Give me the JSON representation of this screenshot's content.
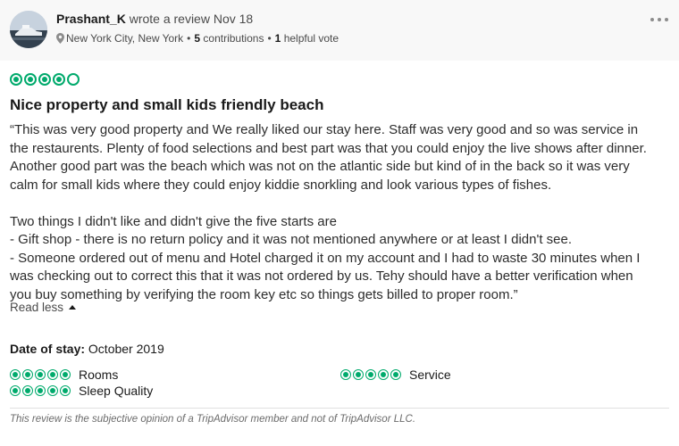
{
  "header": {
    "author_name": "Prashant_K",
    "author_action": "wrote a review Nov 18",
    "location": "New York City, New York",
    "contributions_count": "5",
    "contributions_label": "contributions",
    "helpful_count": "1",
    "helpful_label": "helpful vote",
    "separator": "•"
  },
  "review": {
    "rating": 4,
    "rating_max": 5,
    "title": "Nice property and small kids friendly beach",
    "paragraph1": [
      "“This was very good property and We really liked our stay here. Staff was very good and so was service in",
      "the restaurents. Plenty of food selections and best part was that you could enjoy the live shows after dinner.",
      "Another good part was the beach which was not on the atlantic side but kind of in the back so it was very",
      "calm for small kids where they could enjoy kiddie snorkling and look various types of fishes."
    ],
    "paragraph2": [
      "Two things I didn't like and didn't give the five starts are",
      "- Gift shop - there is no return policy and it was not mentioned anywhere or at least I didn't see.",
      "- Someone ordered out of menu and Hotel charged it on my account and I had to waste 30 minutes when I",
      "was checking out to correct this that it was not ordered by us. Tehy should have a better verification when",
      "you buy something by verifying the room key etc so things gets billed to proper room.”"
    ],
    "read_less_label": "Read less",
    "date_of_stay_label": "Date of stay:",
    "date_of_stay_value": "October 2019"
  },
  "sub_ratings": [
    {
      "label": "Rooms",
      "rating": 5
    },
    {
      "label": "Service",
      "rating": 5
    },
    {
      "label": "Sleep Quality",
      "rating": 5
    }
  ],
  "disclaimer": "This review is the subjective opinion of a TripAdvisor member and not of TripAdvisor LLC.",
  "colors": {
    "bubble_accent": "#00aa6c",
    "header_background": "#f8f8f8"
  },
  "icons": {
    "location": "map-pin-icon",
    "more": "more-options-icon",
    "read_less": "caret-up-icon"
  }
}
